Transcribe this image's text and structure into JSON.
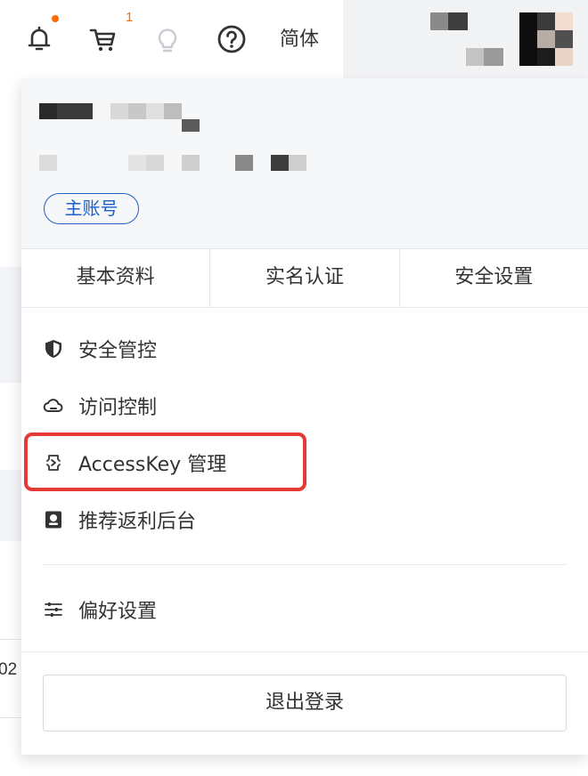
{
  "topbar": {
    "icons": [
      "bell-icon",
      "cart-icon",
      "lightbulb-icon",
      "help-icon"
    ],
    "cart_count": "1",
    "language": "简体",
    "accent_color": "#ff6a00"
  },
  "account_panel": {
    "account_type_badge": "主账号",
    "badge_color": "#1f5fc8",
    "tabs": [
      {
        "label": "基本资料"
      },
      {
        "label": "实名认证"
      },
      {
        "label": "安全设置"
      }
    ],
    "menu_items": [
      {
        "label": "安全管控",
        "icon": "shield-icon"
      },
      {
        "label": "访问控制",
        "icon": "cloud-icon"
      },
      {
        "label": "AccessKey 管理",
        "icon": "key-icon",
        "highlighted": true
      },
      {
        "label": "推荐返利后台",
        "icon": "badge-icon"
      },
      {
        "label": "偏好设置",
        "icon": "sliders-icon"
      }
    ],
    "logout_label": "退出登录",
    "highlight_color": "#e53935"
  },
  "background": {
    "partial_text": "02"
  }
}
